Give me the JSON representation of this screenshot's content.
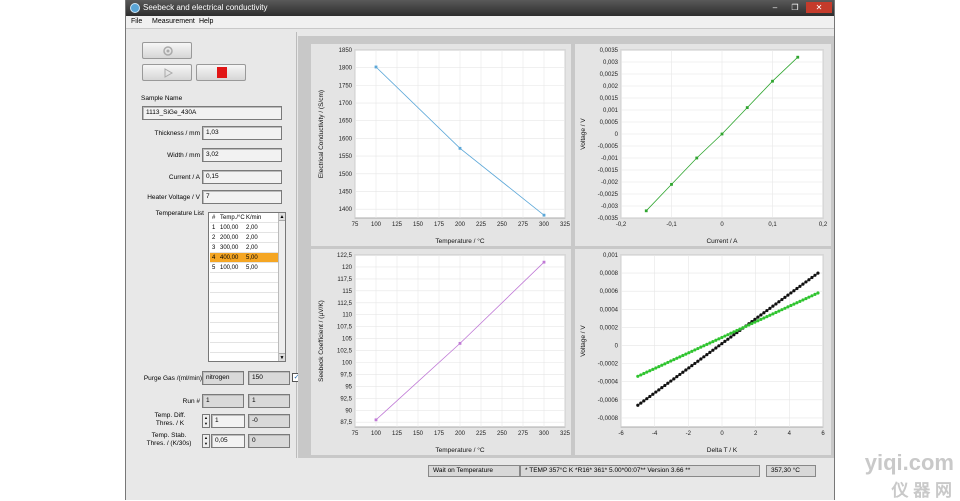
{
  "window": {
    "title": "Seebeck and electrical conductivity",
    "controls": [
      "–",
      "❐",
      "✕"
    ]
  },
  "menu": [
    "File",
    "Measurement",
    "Help"
  ],
  "toolbar": {
    "run_icon": "gear-icon",
    "play_icon": "play-icon",
    "stop_icon": "stop-icon",
    "stop_color": "#e11515"
  },
  "sample": {
    "section_label": "Sample Name",
    "name": "1113_SiGe_430A",
    "thickness_label": "Thickness / mm",
    "thickness": "1,03",
    "width_label": "Width / mm",
    "width": "3,02",
    "current_label": "Current / A",
    "current": "0,15",
    "heater_label": "Heater Voltage / V",
    "heater": "7"
  },
  "temperature_list": {
    "label": "Temperature List",
    "headers": [
      "#",
      "Temp./°C",
      "K/min"
    ],
    "rows": [
      [
        "1",
        "100,00",
        "2,00"
      ],
      [
        "2",
        "200,00",
        "2,00"
      ],
      [
        "3",
        "300,00",
        "2,00"
      ],
      [
        "4",
        "400,00",
        "5,00"
      ],
      [
        "5",
        "100,00",
        "5,00"
      ]
    ],
    "selected_row": 3,
    "selected_color": "#f5a623"
  },
  "gas": {
    "label": "Purge Gas /(ml/min)",
    "type": "nitrogen",
    "flow": "150",
    "checked_mark": "✓"
  },
  "run": {
    "label": "Run #",
    "value": "1",
    "value2": "1"
  },
  "temp_diff": {
    "label": "Temp. Diff.\nThres. / K",
    "value": "1",
    "readout": "-0"
  },
  "temp_stab": {
    "label": "Temp. Stab.\nThres. / (K/30s)",
    "value": "0,05",
    "readout": "0"
  },
  "status": {
    "message": "Wait on Temperature",
    "info": "* TEMP   357°C K  *R16* 361* 5.00*00:07**  Version 3.66  **",
    "temperature": "357,30 °C"
  },
  "watermark": {
    "latin": "yiqi.com",
    "cjk": "仪 器 网"
  },
  "chart_data": [
    {
      "type": "line",
      "xlabel": "Temperature / °C",
      "ylabel": "Electrical Conductivity / (S/cm)",
      "xlim": [
        75,
        325
      ],
      "ylim": [
        1375,
        1850
      ],
      "xticks": [
        "75",
        "100",
        "125",
        "150",
        "175",
        "200",
        "225",
        "250",
        "275",
        "300",
        "325"
      ],
      "yticks": [
        "1400",
        "1450",
        "1500",
        "1550",
        "1600",
        "1650",
        "1700",
        "1750",
        "1800",
        "1850"
      ],
      "series": [
        {
          "x": [
            100,
            200,
            300
          ],
          "y": [
            1802,
            1572,
            1383
          ]
        }
      ],
      "color": "#5ba7d8"
    },
    {
      "type": "line",
      "xlabel": "Current / A",
      "ylabel": "Voltage / V",
      "xlim": [
        -0.2,
        0.2
      ],
      "ylim": [
        -0.0035,
        0.0035
      ],
      "xticks": [
        "-0,2",
        "-0,1",
        "0",
        "0,1",
        "0,2"
      ],
      "yticks": [
        "-0,0035",
        "-0,003",
        "-0,0025",
        "-0,002",
        "-0,0015",
        "-0,001",
        "-0,0005",
        "0",
        "0,0005",
        "0,001",
        "0,0015",
        "0,002",
        "0,0025",
        "0,003",
        "0,0035"
      ],
      "series": [
        {
          "x": [
            -0.15,
            -0.1,
            -0.05,
            0,
            0.05,
            0.1,
            0.15
          ],
          "y": [
            -0.0032,
            -0.0021,
            -0.001,
            0,
            0.0011,
            0.0022,
            0.0032
          ]
        }
      ],
      "color": "#2fa52f"
    },
    {
      "type": "line",
      "xlabel": "Temperature / °C",
      "ylabel": "Seebeck Coefficient / (µV/K)",
      "xlim": [
        75,
        325
      ],
      "ylim": [
        86.5,
        122.5
      ],
      "xticks": [
        "75",
        "100",
        "125",
        "150",
        "175",
        "200",
        "225",
        "250",
        "275",
        "300",
        "325"
      ],
      "yticks": [
        "87,5",
        "90",
        "92,5",
        "95",
        "97,5",
        "100",
        "102,5",
        "105",
        "107,5",
        "110",
        "112,5",
        "115",
        "117,5",
        "120",
        "122,5"
      ],
      "series": [
        {
          "x": [
            100,
            200,
            300
          ],
          "y": [
            88,
            104,
            121
          ]
        }
      ],
      "color": "#c07ad6"
    },
    {
      "type": "scatter",
      "xlabel": "Delta T / K",
      "ylabel": "Voltage / V",
      "xlim": [
        -6,
        6
      ],
      "ylim": [
        -0.0009,
        0.001
      ],
      "xticks": [
        "-6",
        "-4",
        "-2",
        "0",
        "2",
        "4",
        "6"
      ],
      "yticks": [
        "-0,0008",
        "-0,0006",
        "-0,0004",
        "-0,0002",
        "0",
        "0,0002",
        "0,0004",
        "0,0006",
        "0,0008",
        "0,001"
      ],
      "series": [
        {
          "x": [
            -5,
            5.7
          ],
          "y": [
            -0.00066,
            0.0008
          ],
          "color": "#111111"
        },
        {
          "x": [
            -5,
            5.7
          ],
          "y": [
            -0.00034,
            0.00058
          ],
          "color": "#2fc42f"
        }
      ]
    }
  ]
}
